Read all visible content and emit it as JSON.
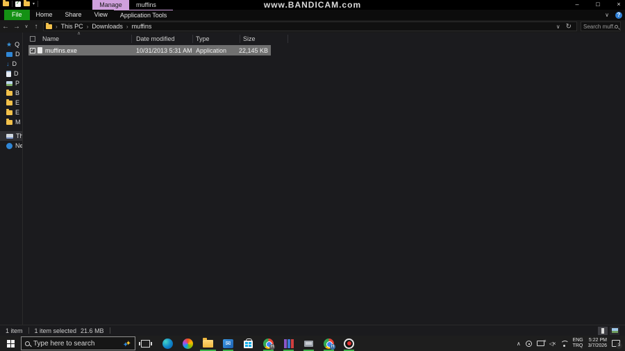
{
  "watermark": "www.BANDICAM.com",
  "window": {
    "title": "muffins",
    "contextual_tab": "Manage",
    "tabs": [
      "File",
      "Home",
      "Share",
      "View",
      "Application Tools"
    ],
    "controls": {
      "minimize": "–",
      "maximize": "□",
      "close": "×",
      "collapse_ribbon": "∨",
      "help": "?"
    },
    "address": {
      "back": "←",
      "forward": "→",
      "recent": "∨",
      "up": "↑",
      "crumbs": [
        "This PC",
        "Downloads",
        "muffins"
      ],
      "crumb_sep": "›",
      "dropdown": "∨",
      "refresh": "↻",
      "search_placeholder": "Search muff..."
    },
    "columns": {
      "name": "Name",
      "date": "Date modified",
      "type": "Type",
      "size": "Size",
      "sort_caret": "∧"
    },
    "file": {
      "name": "muffins.exe",
      "date_modified": "10/31/2013 5:31 AM",
      "type": "Application",
      "size": "22,145 KB"
    },
    "sidebar": [
      {
        "icon": "quick-access-star-icon",
        "label": "Q"
      },
      {
        "icon": "desktop-icon",
        "label": "D"
      },
      {
        "icon": "downloads-arrow-icon",
        "label": "D"
      },
      {
        "icon": "documents-icon",
        "label": "D"
      },
      {
        "icon": "pictures-icon",
        "label": "P"
      },
      {
        "icon": "folder-icon",
        "label": "B"
      },
      {
        "icon": "folder-icon",
        "label": "E"
      },
      {
        "icon": "folder-icon",
        "label": "E"
      },
      {
        "icon": "folder-icon",
        "label": "M"
      },
      {
        "icon": "this-pc-icon",
        "label": "Th"
      },
      {
        "icon": "network-icon",
        "label": "Ne"
      }
    ],
    "status": {
      "items": "1 item",
      "selected": "1 item selected",
      "size": "21.6 MB"
    }
  },
  "taskbar": {
    "search_placeholder": "Type here to search",
    "apps": [
      "edge",
      "copilot",
      "file-explorer",
      "mail",
      "store",
      "chrome-profile-h",
      "winrar",
      "remote-pc",
      "chrome-profile-b",
      "bandicam-record"
    ],
    "tray": {
      "hidden_icons": "∧",
      "lang_top": "ENG",
      "lang_bottom": "TRQ",
      "time": "5:22 PM",
      "date": "3/7/2026",
      "notification_badge": "3"
    }
  },
  "colors": {
    "file_tab_green": "#149114",
    "manage_pink": "#cfa0dd",
    "selection_gray": "#707070",
    "running_indicator_green": "#3cb24a",
    "record_red": "#e03131",
    "accent_blue": "#2f86d6"
  }
}
